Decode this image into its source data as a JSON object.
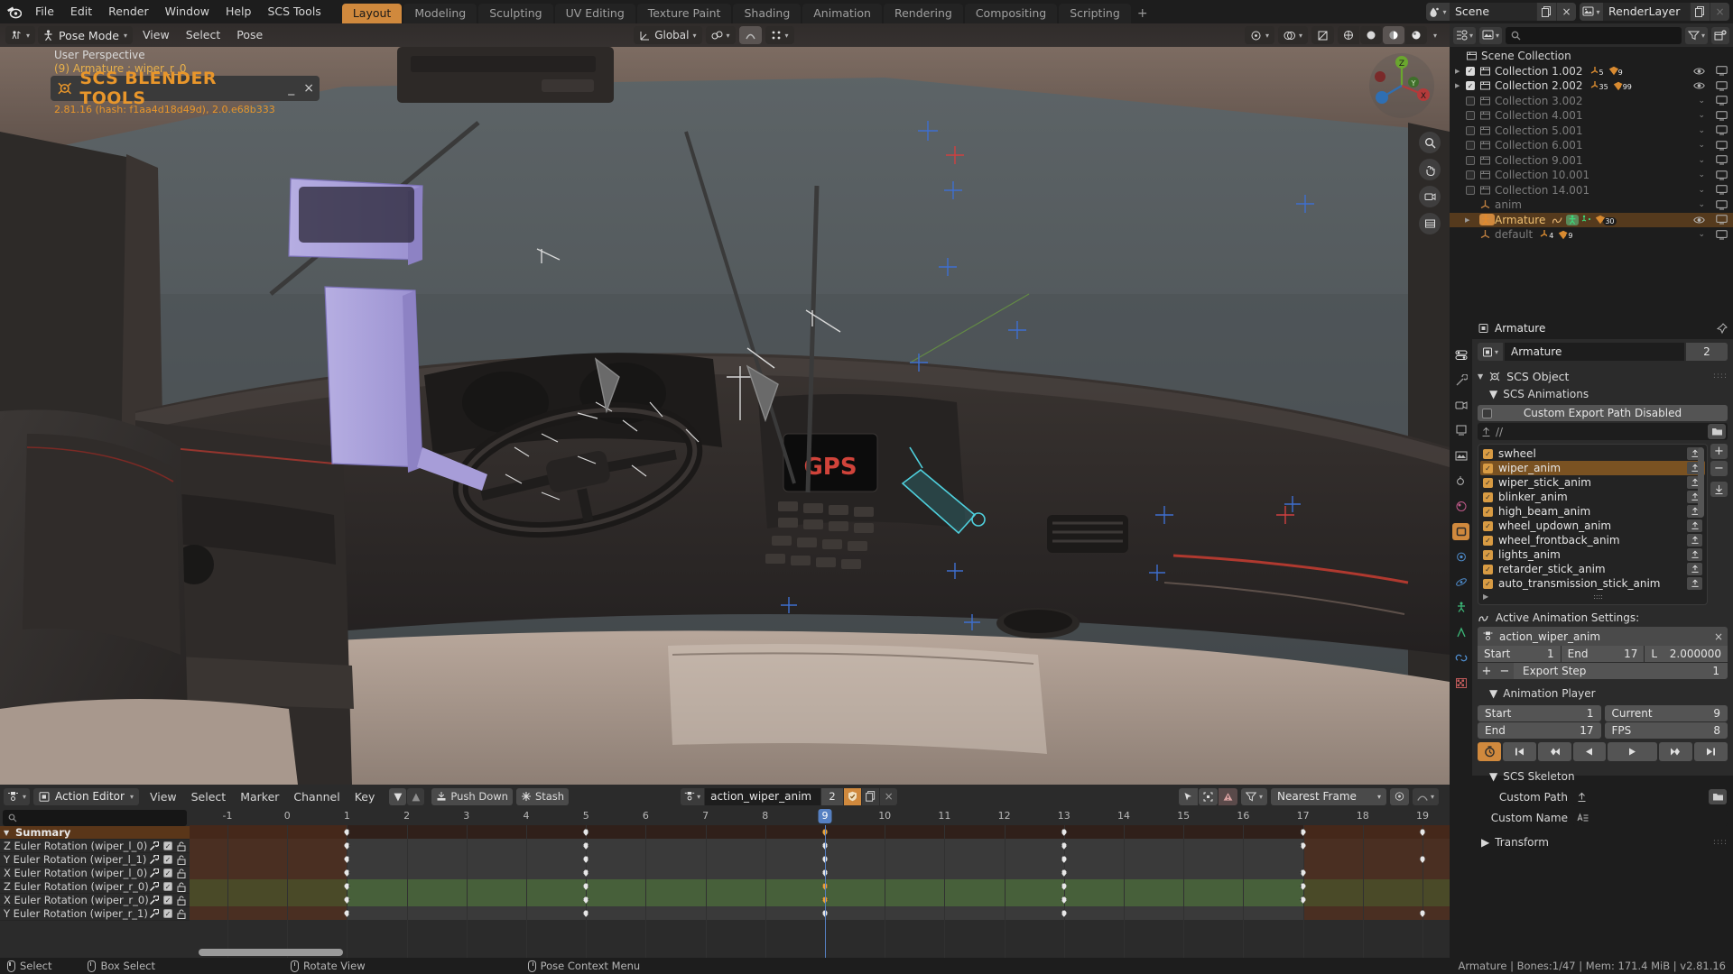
{
  "topbar": {
    "menus": [
      "File",
      "Edit",
      "Render",
      "Window",
      "Help",
      "SCS Tools"
    ],
    "workspaces": [
      "Layout",
      "Modeling",
      "Sculpting",
      "UV Editing",
      "Texture Paint",
      "Shading",
      "Animation",
      "Rendering",
      "Compositing",
      "Scripting"
    ],
    "active_workspace": "Layout",
    "add_workspace": "+",
    "scene_name": "Scene",
    "viewlayer_name": "RenderLayer",
    "logo_icon": "blender-logo-icon"
  },
  "viewport": {
    "mode": "Pose Mode",
    "menus": [
      "View",
      "Select",
      "Pose"
    ],
    "transform_orientation": "Global",
    "perspective_label": "User Perspective",
    "object_label": "(9) Armature : wiper_r_0",
    "addon": {
      "title": "SCS BLENDER TOOLS",
      "version": "2.81.16 (hash: f1aa4d18d49d), 2.0.e68b333",
      "minimize_label": "_",
      "close_label": "×"
    },
    "gizmo_axes": [
      "X",
      "Y",
      "Z"
    ]
  },
  "outliner": {
    "search_placeholder": "",
    "display_mode_icon": "outliner-display-mode-icon",
    "filter_icon": "filter-icon",
    "new_collection_icon": "new-collection-icon",
    "root": "Scene Collection",
    "rows": [
      {
        "label": "Collection 1.002",
        "checked": true,
        "dim": false,
        "expandable": true,
        "indent": 1,
        "stats": [
          "5",
          "9"
        ],
        "eye": true
      },
      {
        "label": "Collection 2.002",
        "checked": true,
        "dim": false,
        "expandable": true,
        "indent": 1,
        "stats": [
          "35",
          "99"
        ],
        "eye": true
      },
      {
        "label": "Collection 3.002",
        "checked": false,
        "dim": true,
        "expandable": false,
        "indent": 1,
        "stats": [],
        "eye": false
      },
      {
        "label": "Collection 4.001",
        "checked": false,
        "dim": true,
        "expandable": false,
        "indent": 1,
        "stats": [],
        "eye": false
      },
      {
        "label": "Collection 5.001",
        "checked": false,
        "dim": true,
        "expandable": false,
        "indent": 1,
        "stats": [],
        "eye": false
      },
      {
        "label": "Collection 6.001",
        "checked": false,
        "dim": true,
        "expandable": false,
        "indent": 1,
        "stats": [],
        "eye": false
      },
      {
        "label": "Collection 9.001",
        "checked": false,
        "dim": true,
        "expandable": false,
        "indent": 1,
        "stats": [],
        "eye": false
      },
      {
        "label": "Collection 10.001",
        "checked": false,
        "dim": true,
        "expandable": false,
        "indent": 1,
        "stats": [],
        "eye": false
      },
      {
        "label": "Collection 14.001",
        "checked": false,
        "dim": true,
        "expandable": false,
        "indent": 1,
        "stats": [],
        "eye": false
      },
      {
        "label": "anim",
        "checked": null,
        "dim": true,
        "expandable": false,
        "indent": 1,
        "stats": [],
        "eye": false,
        "kind": "empty"
      },
      {
        "label": "Armature",
        "checked": null,
        "dim": false,
        "expandable": true,
        "indent": 2,
        "stats": [
          "30"
        ],
        "eye": true,
        "kind": "armature",
        "selected": true
      },
      {
        "label": "default",
        "checked": null,
        "dim": true,
        "expandable": false,
        "indent": 1,
        "stats": [
          "4",
          "9"
        ],
        "eye": false,
        "kind": "empty"
      }
    ]
  },
  "properties": {
    "breadcrumb": "Armature",
    "pin_icon": "pin-icon",
    "id_name": "Armature",
    "id_users": "2",
    "scs_object": "SCS Object",
    "scs_animations": "SCS Animations",
    "custom_export_path": "Custom Export Path Disabled",
    "export_path_value": "//",
    "animations": [
      {
        "name": "swheel",
        "checked": true,
        "selected": false
      },
      {
        "name": "wiper_anim",
        "checked": true,
        "selected": true
      },
      {
        "name": "wiper_stick_anim",
        "checked": true,
        "selected": false
      },
      {
        "name": "blinker_anim",
        "checked": true,
        "selected": false
      },
      {
        "name": "high_beam_anim",
        "checked": true,
        "selected": false
      },
      {
        "name": "wheel_updown_anim",
        "checked": true,
        "selected": false
      },
      {
        "name": "wheel_frontback_anim",
        "checked": true,
        "selected": false
      },
      {
        "name": "lights_anim",
        "checked": true,
        "selected": false
      },
      {
        "name": "retarder_stick_anim",
        "checked": true,
        "selected": false
      },
      {
        "name": "auto_transmission_stick_anim",
        "checked": true,
        "selected": false
      }
    ],
    "list_add": "+",
    "list_remove": "−",
    "list_down_icon": "download-icon",
    "active_animation_settings": "Active Animation Settings:",
    "active_action": "action_wiper_anim",
    "active_action_close": "×",
    "start_label": "Start",
    "start_value": "1",
    "end_label": "End",
    "end_value": "17",
    "length_label": "L",
    "length_value": "2.000000",
    "export_step_label": "Export Step",
    "export_step_value": "1",
    "animation_player": "Animation Player",
    "player_start_label": "Start",
    "player_start_value": "1",
    "player_end_label": "End",
    "player_end_value": "17",
    "player_current_label": "Current",
    "player_current_value": "9",
    "player_fps_label": "FPS",
    "player_fps_value": "8",
    "player_buttons": [
      "record-icon",
      "jump-start-icon",
      "prev-keyframe-icon",
      "play-reverse-icon",
      "play-icon",
      "next-keyframe-icon",
      "jump-end-icon"
    ],
    "scs_skeleton": "SCS Skeleton",
    "custom_path_label": "Custom Path",
    "custom_path_value": "",
    "custom_name_label": "Custom Name",
    "custom_name_value": "",
    "transform": "Transform"
  },
  "dopesheet": {
    "editor_name": "Action Editor",
    "menus": [
      "View",
      "Select",
      "Marker",
      "Channel",
      "Key"
    ],
    "push_down": "Push Down",
    "stash": "Stash",
    "action_name": "action_wiper_anim",
    "action_users": "2",
    "fake_user_icon": "shield-icon",
    "copy_icon": "copy-icon",
    "unlink_icon": "x-icon",
    "snap_mode": "Nearest Frame",
    "proportional_icon": "proportional-edit-icon",
    "falloff_icon": "falloff-curve-icon",
    "search_placeholder": "",
    "summary": "Summary",
    "channels": [
      {
        "label": "Z Euler Rotation (wiper_l_0)",
        "tint": "brown"
      },
      {
        "label": "Y Euler Rotation (wiper_l_1)",
        "tint": "brown"
      },
      {
        "label": "X Euler Rotation (wiper_l_0)",
        "tint": "brown"
      },
      {
        "label": "Z Euler Rotation (wiper_r_0)",
        "tint": "green"
      },
      {
        "label": "X Euler Rotation (wiper_r_0)",
        "tint": "green"
      },
      {
        "label": "Y Euler Rotation (wiper_r_1)",
        "tint": "brown"
      }
    ],
    "ruler_ticks": [
      "-1",
      "0",
      "1",
      "2",
      "3",
      "4",
      "5",
      "6",
      "7",
      "8",
      "9",
      "10",
      "11",
      "12",
      "13",
      "14",
      "15",
      "16",
      "17",
      "18",
      "19"
    ],
    "playhead_frame": 9,
    "frame_range": [
      1,
      17
    ],
    "keyframes": {
      "summary": [
        1,
        5,
        9,
        13,
        17,
        19
      ],
      "rows": [
        [
          1,
          5,
          9,
          13,
          17
        ],
        [
          1,
          5,
          9,
          13,
          19
        ],
        [
          1,
          5,
          9,
          13,
          17
        ],
        [
          1,
          5,
          9,
          13,
          17
        ],
        [
          1,
          5,
          9,
          13,
          17
        ],
        [
          1,
          5,
          9,
          13,
          19
        ]
      ]
    }
  },
  "statusbar": {
    "hints": [
      {
        "mouse": "left",
        "label": "Select"
      },
      {
        "mouse": "left-drag",
        "label": "Box Select"
      },
      {
        "mouse": "middle",
        "label": "Rotate View"
      },
      {
        "mouse": "right",
        "label": "Pose Context Menu"
      }
    ],
    "info": "Armature | Bones:1/47  | Mem: 171.4 MiB | v2.81.16"
  },
  "colors": {
    "accent": "#d0893d",
    "selected_row": "#553a1d",
    "playhead": "#5680c2",
    "scs_orange": "#e8962b",
    "keyframe": "#e8e8e8"
  }
}
